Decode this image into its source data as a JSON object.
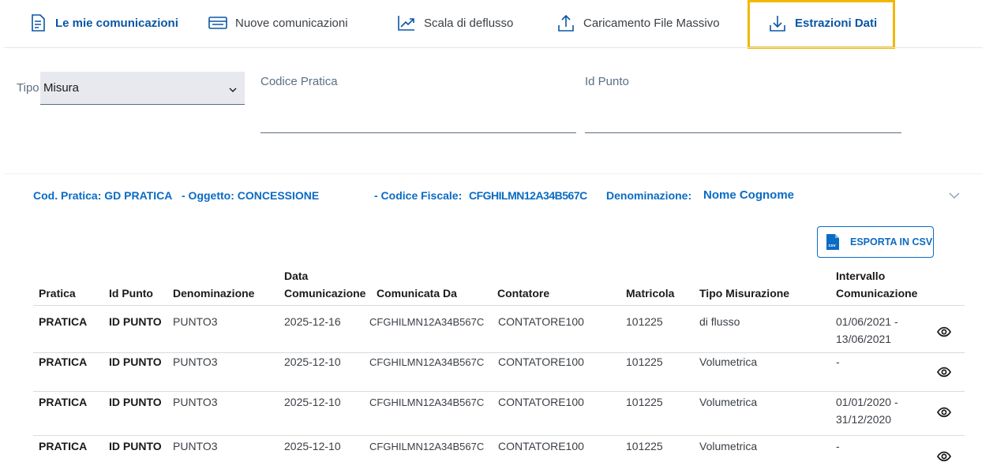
{
  "nav": {
    "items": [
      {
        "label": "Le mie comunicazioni",
        "icon": "document-icon"
      },
      {
        "label": "Nuove comunicazioni",
        "icon": "card-list-icon"
      },
      {
        "label": "Scala di deflusso",
        "icon": "trend-chart-icon"
      },
      {
        "label": "Caricamento File Massivo",
        "icon": "upload-icon"
      },
      {
        "label": "Estrazioni Dati",
        "icon": "download-icon"
      }
    ]
  },
  "filters": {
    "tipo_label": "Tipo",
    "tipo_value": "Misura",
    "codice_pratica_label": "Codice Pratica",
    "id_punto_label": "Id Punto"
  },
  "accordion": {
    "cod_pratica": "Cod. Pratica: GD PRATICA",
    "oggetto": "- Oggetto: CONCESSIONE",
    "codice_fiscale_label": "- Codice Fiscale:",
    "codice_fiscale_value": "CFGHILMN12A34B567C",
    "denominazione_label": "Denominazione:",
    "denominazione_value": "Nome Cognome"
  },
  "export_button": {
    "label": "ESPORTA IN CSV",
    "icon_text": "csv"
  },
  "table": {
    "headers": {
      "pratica": "Pratica",
      "id_punto": "Id Punto",
      "denominazione": "Denominazione",
      "data_1": "Data",
      "data_2": "Comunicazione",
      "comunicata_da": "Comunicata Da",
      "contatore": "Contatore",
      "matricola": "Matricola",
      "tipo_misurazione": "Tipo Misurazione",
      "intervallo_1": "Intervallo",
      "intervallo_2": "Comunicazione"
    },
    "rows": [
      {
        "pratica": "PRATICA",
        "id_punto": "ID PUNTO",
        "denominazione": "PUNTO3",
        "data": "2025-12-16",
        "comunicata_da": "CFGHILMN12A34B567C",
        "contatore": "CONTATORE100",
        "matricola": "101225",
        "tipo": "di flusso",
        "intervallo_1": "01/06/2021 -",
        "intervallo_2": "13/06/2021"
      },
      {
        "pratica": "PRATICA",
        "id_punto": "ID PUNTO",
        "denominazione": "PUNTO3",
        "data": "2025-12-10",
        "comunicata_da": "CFGHILMN12A34B567C",
        "contatore": "CONTATORE100",
        "matricola": "101225",
        "tipo": "Volumetrica",
        "intervallo_1": "-",
        "intervallo_2": ""
      },
      {
        "pratica": "PRATICA",
        "id_punto": "ID PUNTO",
        "denominazione": "PUNTO3",
        "data": "2025-12-10",
        "comunicata_da": "CFGHILMN12A34B567C",
        "contatore": "CONTATORE100",
        "matricola": "101225",
        "tipo": "Volumetrica",
        "intervallo_1": "01/01/2020 -",
        "intervallo_2": "31/12/2020"
      },
      {
        "pratica": "PRATICA",
        "id_punto": "ID PUNTO",
        "denominazione": "PUNTO3",
        "data": "2025-12-10",
        "comunicata_da": "CFGHILMN12A34B567C",
        "contatore": "CONTATORE100",
        "matricola": "101225",
        "tipo": "Volumetrica",
        "intervallo_1": "-",
        "intervallo_2": ""
      }
    ]
  },
  "colors": {
    "primary": "#0a6bc4",
    "nav_active": "#0a56a5",
    "highlight": "#f2b705"
  }
}
